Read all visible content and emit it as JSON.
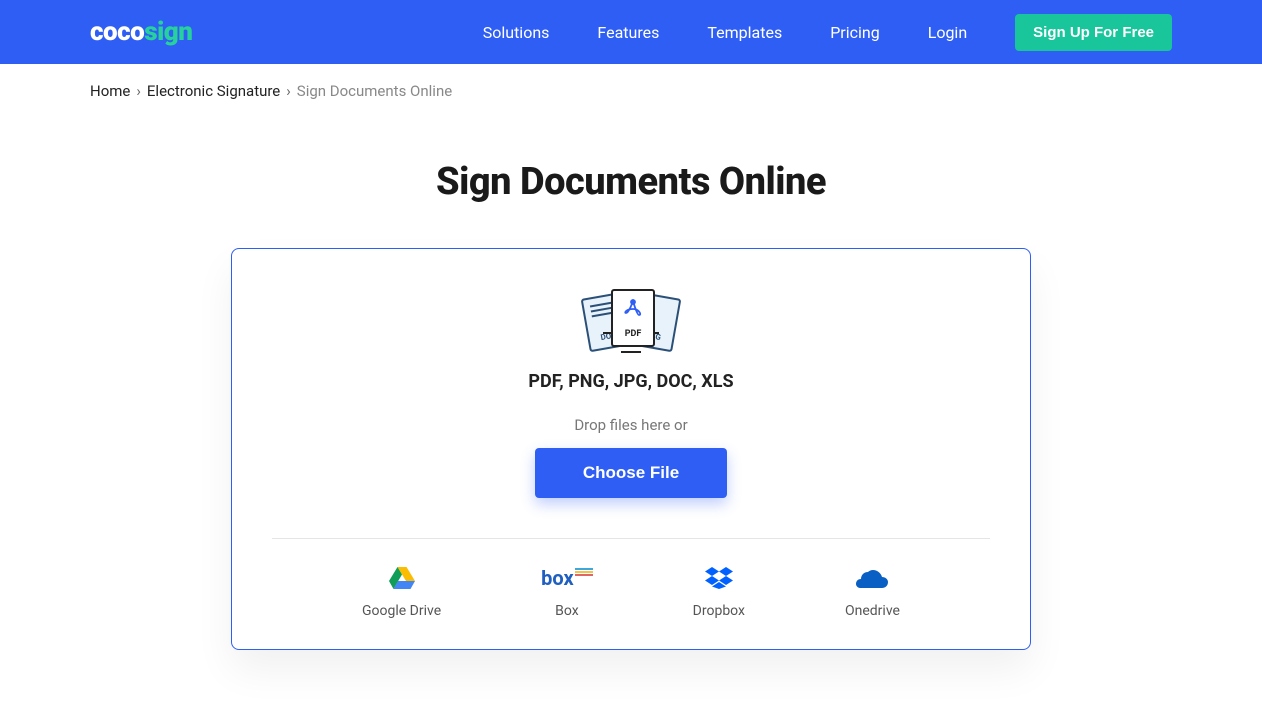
{
  "header": {
    "logo_coco": "coco",
    "logo_sign": "sign",
    "nav": {
      "solutions": "Solutions",
      "features": "Features",
      "templates": "Templates",
      "pricing": "Pricing",
      "login": "Login"
    },
    "signup": "Sign Up For Free"
  },
  "breadcrumb": {
    "home": "Home",
    "electronic_signature": "Electronic Signature",
    "current": "Sign Documents Online"
  },
  "main": {
    "title": "Sign Documents Online",
    "formats": "PDF, PNG, JPG, DOC, XLS",
    "drop_text": "Drop files here or",
    "choose_file": "Choose File"
  },
  "providers": {
    "google_drive": "Google Drive",
    "box": "Box",
    "dropbox": "Dropbox",
    "onedrive": "Onedrive"
  }
}
